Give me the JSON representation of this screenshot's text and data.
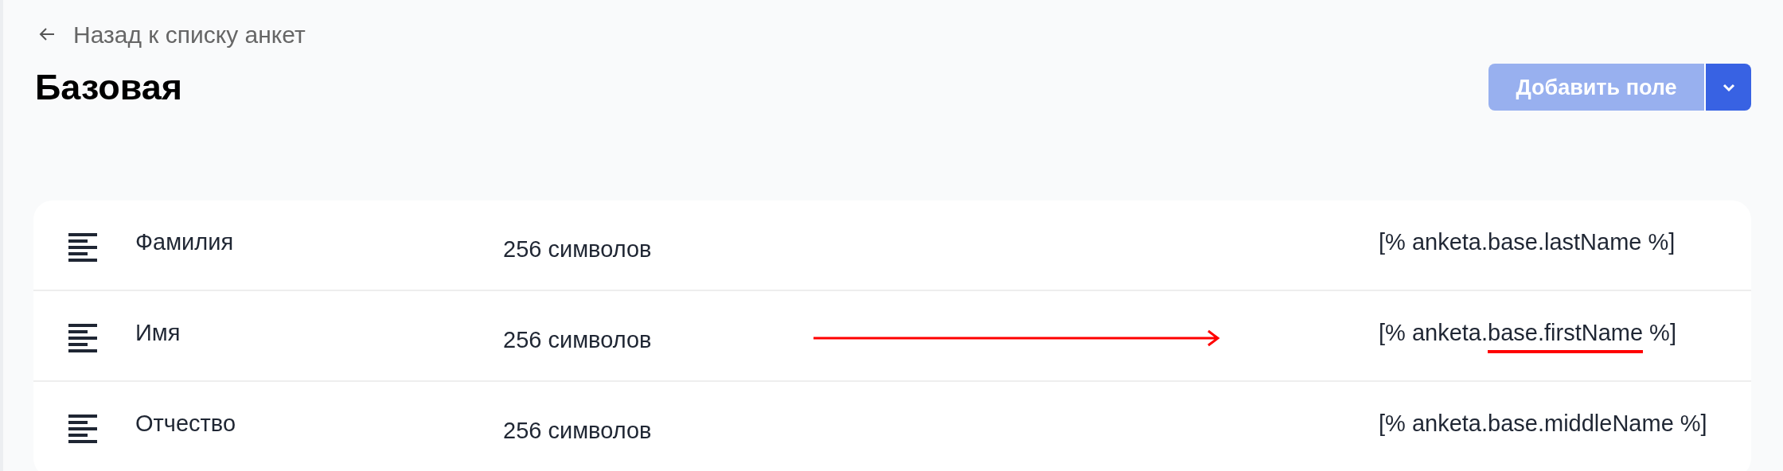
{
  "back_link": {
    "label": "Назад к списку анкет"
  },
  "title": "Базовая",
  "add_button": {
    "label": "Добавить поле",
    "disabled": true
  },
  "fields": [
    {
      "name": "Фамилия",
      "size": "256 символов",
      "variable": "[% anketa.base.lastName %]",
      "annotated": false
    },
    {
      "name": "Имя",
      "size": "256 символов",
      "variable": "[% anketa.base.firstName %]",
      "annotated": true
    },
    {
      "name": "Отчество",
      "size": "256 символов",
      "variable": "[% anketa.base.middleName %]",
      "annotated": false
    }
  ]
}
